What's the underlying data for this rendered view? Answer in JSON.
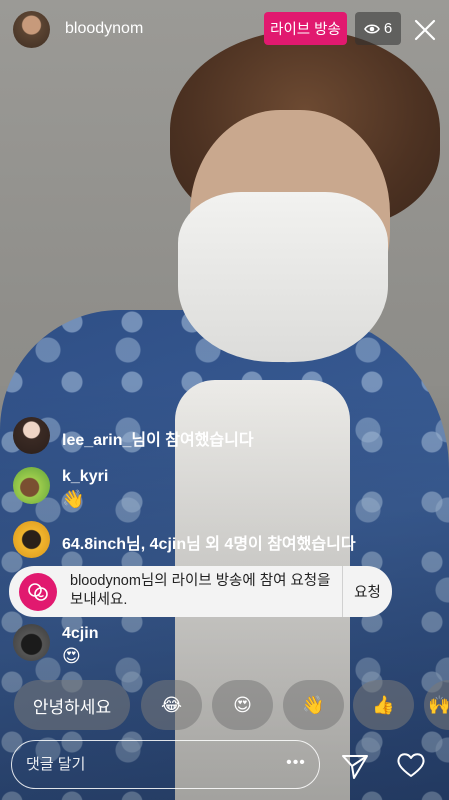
{
  "header": {
    "host_username": "bloodynom",
    "live_label": "라이브 방송",
    "viewer_count": "6"
  },
  "comments": [
    {
      "text": "lee_arin_님이 참여했습니다"
    },
    {
      "user": "k_kyri",
      "text": "👋"
    },
    {
      "text": "64.8inch님, 4cjin님 외 4명이 참여했습니다"
    },
    {
      "user": "4cjin",
      "text": "😍"
    }
  ],
  "request_banner": {
    "text": "bloodynom님의 라이브 방송에 참여 요청을 보내세요.",
    "button_label": "요청"
  },
  "quick_replies": [
    "안녕하세요",
    "😂",
    "😍",
    "👋",
    "👍",
    "🙌"
  ],
  "footer": {
    "comment_placeholder": "댓글 달기",
    "more_label": "•••"
  },
  "icons": {
    "viewer": "eye-icon",
    "close": "close-icon",
    "request": "join-request-icon",
    "send": "send-icon",
    "like": "heart-icon"
  },
  "colors": {
    "live_badge": "#e1196f",
    "request_banner_bg": "#f3f3f3"
  }
}
